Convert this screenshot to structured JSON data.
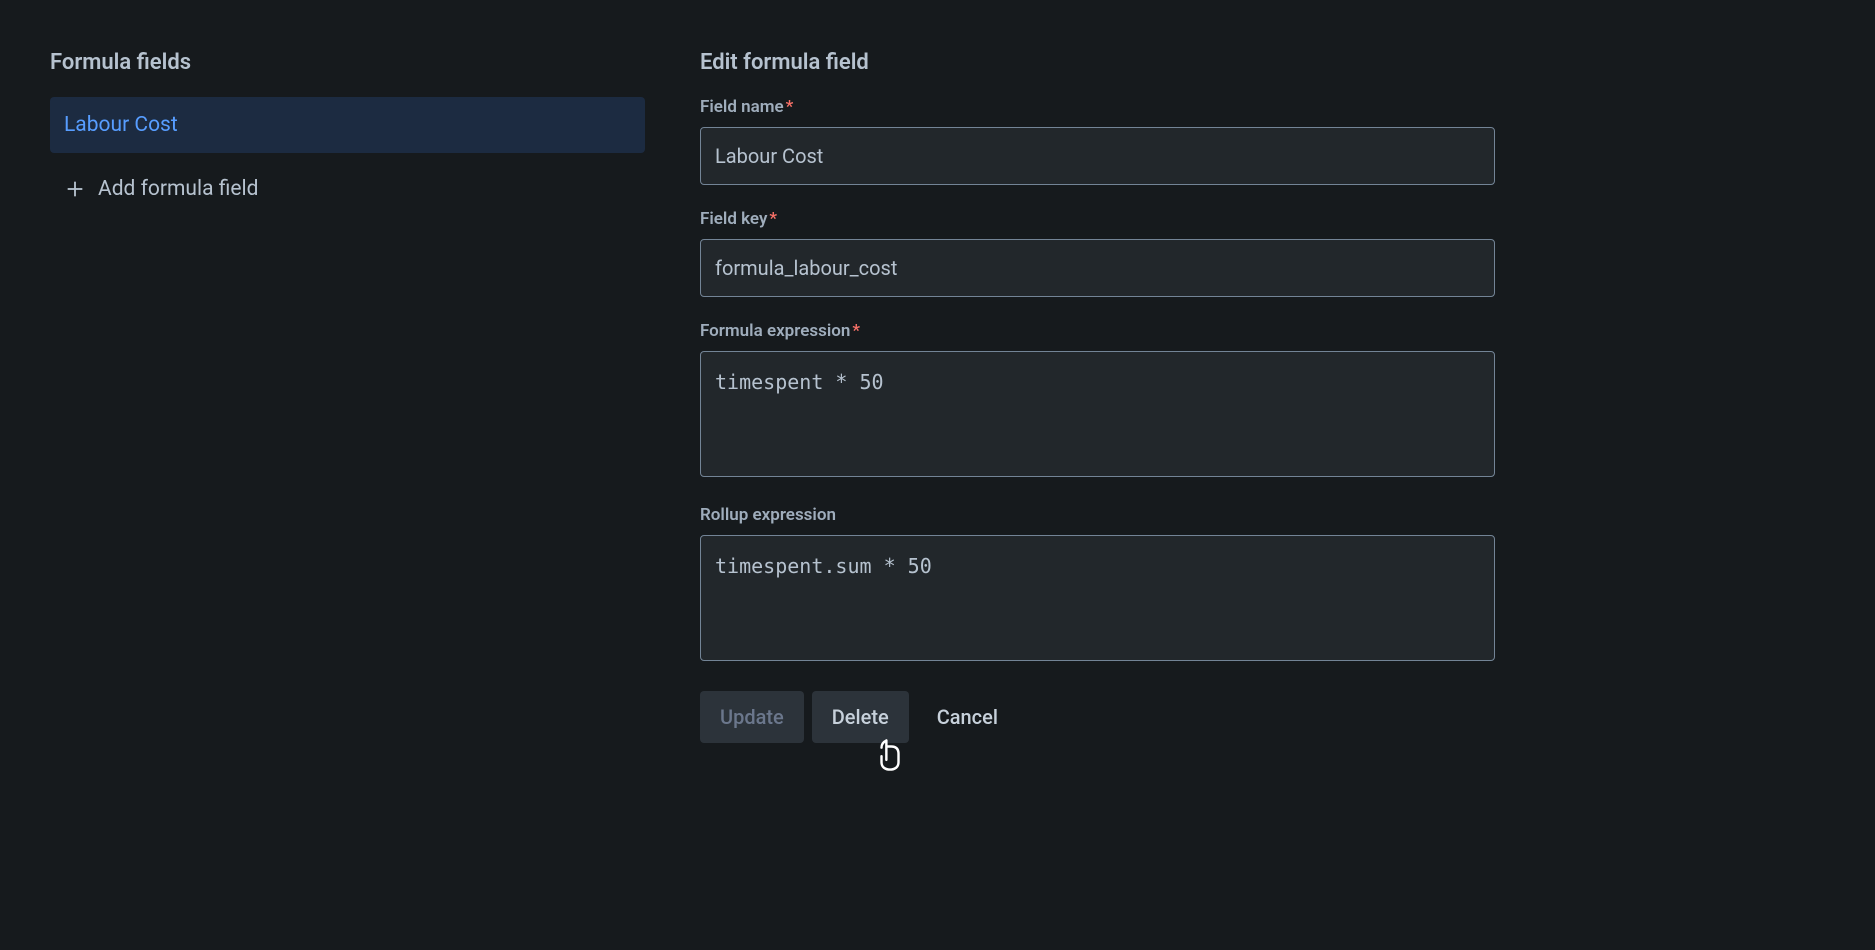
{
  "sidebar": {
    "title": "Formula fields",
    "items": [
      "Labour Cost"
    ],
    "add_label": "Add formula field"
  },
  "editor": {
    "title": "Edit formula field",
    "field_name": {
      "label": "Field name",
      "value": "Labour Cost"
    },
    "field_key": {
      "label": "Field key",
      "value": "formula_labour_cost"
    },
    "formula_expression": {
      "label": "Formula expression",
      "value": "timespent * 50"
    },
    "rollup_expression": {
      "label": "Rollup expression",
      "value": "timespent.sum * 50"
    },
    "buttons": {
      "update": "Update",
      "delete": "Delete",
      "cancel": "Cancel"
    }
  }
}
